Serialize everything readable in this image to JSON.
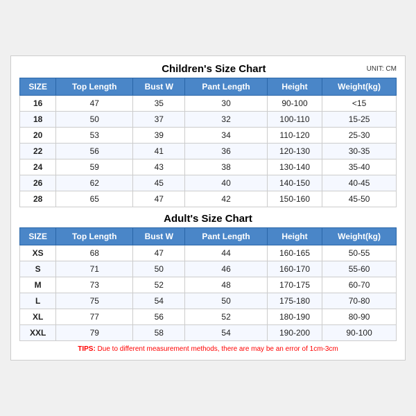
{
  "children": {
    "title": "Children's Size Chart",
    "unit": "UNIT: CM",
    "headers": [
      "SIZE",
      "Top Length",
      "Bust W",
      "Pant Length",
      "Height",
      "Weight(kg)"
    ],
    "rows": [
      [
        "16",
        "47",
        "35",
        "30",
        "90-100",
        "<15"
      ],
      [
        "18",
        "50",
        "37",
        "32",
        "100-110",
        "15-25"
      ],
      [
        "20",
        "53",
        "39",
        "34",
        "110-120",
        "25-30"
      ],
      [
        "22",
        "56",
        "41",
        "36",
        "120-130",
        "30-35"
      ],
      [
        "24",
        "59",
        "43",
        "38",
        "130-140",
        "35-40"
      ],
      [
        "26",
        "62",
        "45",
        "40",
        "140-150",
        "40-45"
      ],
      [
        "28",
        "65",
        "47",
        "42",
        "150-160",
        "45-50"
      ]
    ]
  },
  "adults": {
    "title": "Adult's Size Chart",
    "headers": [
      "SIZE",
      "Top Length",
      "Bust W",
      "Pant Length",
      "Height",
      "Weight(kg)"
    ],
    "rows": [
      [
        "XS",
        "68",
        "47",
        "44",
        "160-165",
        "50-55"
      ],
      [
        "S",
        "71",
        "50",
        "46",
        "160-170",
        "55-60"
      ],
      [
        "M",
        "73",
        "52",
        "48",
        "170-175",
        "60-70"
      ],
      [
        "L",
        "75",
        "54",
        "50",
        "175-180",
        "70-80"
      ],
      [
        "XL",
        "77",
        "56",
        "52",
        "180-190",
        "80-90"
      ],
      [
        "XXL",
        "79",
        "58",
        "54",
        "190-200",
        "90-100"
      ]
    ]
  },
  "tips": {
    "label": "TIPS:",
    "text": " Due to different measurement methods, there are may be an error of 1cm-3cm"
  }
}
